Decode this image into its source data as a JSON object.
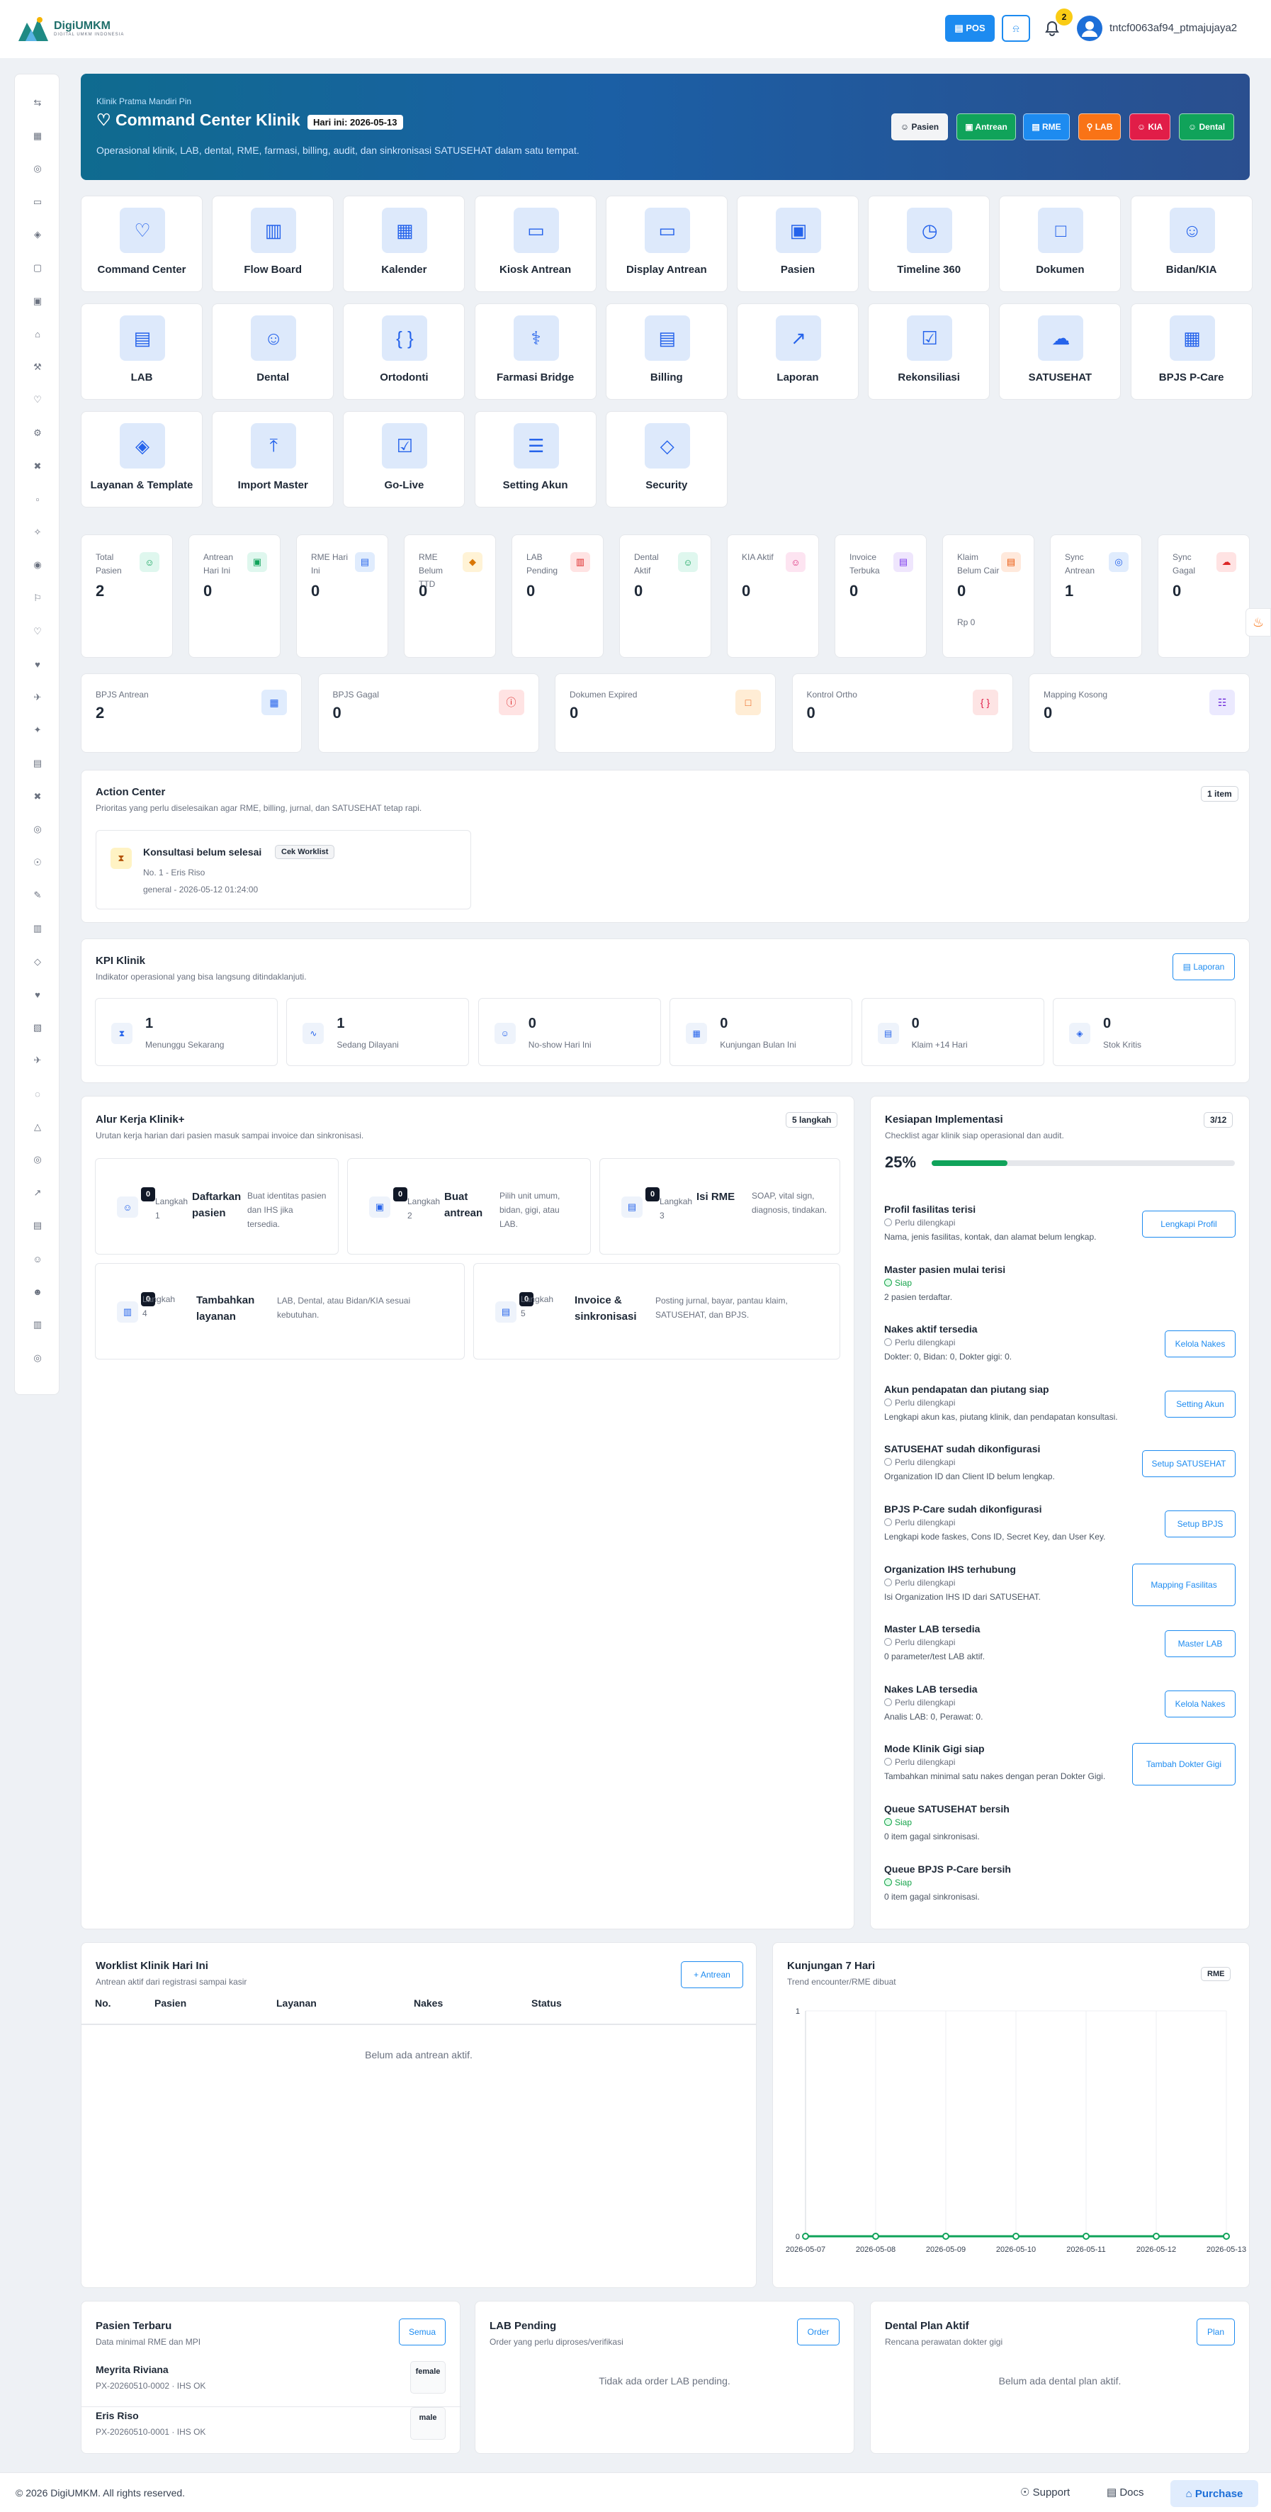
{
  "app": {
    "logo_name": "DigiUMKM",
    "logo_tagline": "DIGITAL UMKM INDONESIA",
    "pos": "▤ POS",
    "bell_icon": "⍾",
    "notif_count": "2",
    "user": "tntcf0063af94_ptmajujaya2"
  },
  "sidebar": [
    "⇆",
    "▦",
    "◎",
    "▭",
    "◈",
    "▢",
    "▣",
    "⌂",
    "⚒",
    "♡",
    "⚙",
    "✖",
    "▫",
    "✧",
    "◉",
    "⚐",
    "♡",
    "♥",
    "✈",
    "✦",
    "▤",
    "✖",
    "◎",
    "☉",
    "✎",
    "▥",
    "◇",
    "♥",
    "▧",
    "✈",
    "◌",
    "△",
    "◎",
    "↗",
    "▤",
    "☺",
    "☻",
    "▥",
    "◎"
  ],
  "hero": {
    "kicker": "Klinik Pratma Mandiri Pin",
    "title": "Command Center Klinik",
    "date": "Hari ini: 2026-05-13",
    "subtitle": "Operasional klinik, LAB, dental, RME, farmasi, billing, audit, dan sinkronisasi SATUSEHAT dalam satu tempat.",
    "buttons": [
      {
        "label": "☺ Pasien",
        "bg": "#f3f4f6",
        "fg": "#1f2937"
      },
      {
        "label": "▣ Antrean",
        "bg": "#10a35a",
        "fg": "#ffffff"
      },
      {
        "label": "▤ RME",
        "bg": "#1d8bf0",
        "fg": "#ffffff"
      },
      {
        "label": "⚲ LAB",
        "bg": "#f97316",
        "fg": "#ffffff"
      },
      {
        "label": "☺ KIA",
        "bg": "#e11d48",
        "fg": "#ffffff"
      },
      {
        "label": "☺ Dental",
        "bg": "#10a35a",
        "fg": "#ffffff"
      }
    ]
  },
  "tiles": [
    {
      "label": "Command Center",
      "icon": "♡"
    },
    {
      "label": "Flow Board",
      "icon": "▥"
    },
    {
      "label": "Kalender",
      "icon": "▦"
    },
    {
      "label": "Kiosk Antrean",
      "icon": "▭"
    },
    {
      "label": "Display Antrean",
      "icon": "▭"
    },
    {
      "label": "Pasien",
      "icon": "▣"
    },
    {
      "label": "Timeline 360",
      "icon": "◷"
    },
    {
      "label": "Dokumen",
      "icon": "□"
    },
    {
      "label": "Bidan/KIA",
      "icon": "☺"
    },
    {
      "label": "LAB",
      "icon": "▤"
    },
    {
      "label": "Dental",
      "icon": "☺"
    },
    {
      "label": "Ortodonti",
      "icon": "{ }"
    },
    {
      "label": "Farmasi Bridge",
      "icon": "⚕"
    },
    {
      "label": "Billing",
      "icon": "▤"
    },
    {
      "label": "Laporan",
      "icon": "↗"
    },
    {
      "label": "Rekonsiliasi",
      "icon": "☑"
    },
    {
      "label": "SATUSEHAT",
      "icon": "☁"
    },
    {
      "label": "BPJS P-Care",
      "icon": "▦"
    },
    {
      "label": "Layanan & Template",
      "icon": "◈"
    },
    {
      "label": "Import Master",
      "icon": "⤒"
    },
    {
      "label": "Go-Live",
      "icon": "☑"
    },
    {
      "label": "Setting Akun",
      "icon": "☰"
    },
    {
      "label": "Security",
      "icon": "◇"
    }
  ],
  "stats": [
    {
      "label": "Total Pasien",
      "value": "2",
      "icon": "☺",
      "bg": "#dff7ee",
      "fg": "#10a35a"
    },
    {
      "label": "Antrean Hari Ini",
      "value": "0",
      "icon": "▣",
      "bg": "#dff7ee",
      "fg": "#10a35a"
    },
    {
      "label": "RME Hari Ini",
      "value": "0",
      "icon": "▤",
      "bg": "#e0ecfd",
      "fg": "#2563eb"
    },
    {
      "label": "RME Belum TTD",
      "value": "0",
      "icon": "◆",
      "bg": "#fff3d6",
      "fg": "#d97706"
    },
    {
      "label": "LAB Pending",
      "value": "0",
      "icon": "▥",
      "bg": "#ffe3e3",
      "fg": "#dc2626"
    },
    {
      "label": "Dental Aktif",
      "value": "0",
      "icon": "☺",
      "bg": "#dff7ee",
      "fg": "#10a35a"
    },
    {
      "label": "KIA Aktif",
      "value": "0",
      "icon": "☺",
      "bg": "#fde4f1",
      "fg": "#db2777"
    },
    {
      "label": "Invoice Terbuka",
      "value": "0",
      "icon": "▤",
      "bg": "#efe6fd",
      "fg": "#7c3aed"
    },
    {
      "label": "Klaim Belum Cair",
      "value": "0",
      "icon": "▤",
      "bg": "#ffe9dc",
      "fg": "#ea580c",
      "extra": "Rp 0"
    },
    {
      "label": "Sync Antrean",
      "value": "1",
      "icon": "◎",
      "bg": "#e0ecfd",
      "fg": "#2563eb"
    },
    {
      "label": "Sync Gagal",
      "value": "0",
      "icon": "☁",
      "bg": "#ffe3e3",
      "fg": "#dc2626"
    }
  ],
  "stats2": [
    {
      "label": "BPJS Antrean",
      "value": "2",
      "icon": "▦",
      "bg": "#e0ecfd",
      "fg": "#2563eb"
    },
    {
      "label": "BPJS Gagal",
      "value": "0",
      "icon": "ⓘ",
      "bg": "#ffe3e3",
      "fg": "#dc2626"
    },
    {
      "label": "Dokumen Expired",
      "value": "0",
      "icon": "□",
      "bg": "#ffedd5",
      "fg": "#ea580c"
    },
    {
      "label": "Kontrol Ortho",
      "value": "0",
      "icon": "{ }",
      "bg": "#fde4e4",
      "fg": "#e11d48"
    },
    {
      "label": "Mapping Kosong",
      "value": "0",
      "icon": "☷",
      "bg": "#ebe9fe",
      "fg": "#6d28d9"
    }
  ],
  "action": {
    "title": "Action Center",
    "sub": "Prioritas yang perlu diselesaikan agar RME, billing, jurnal, dan SATUSEHAT tetap rapi.",
    "count": "1 item",
    "item_title": "Konsultasi belum selesai",
    "item_btn": "Cek Worklist",
    "item_l1": "No. 1 - Eris Riso",
    "item_l2": "general - 2026-05-12 01:24:00",
    "item_icon": "⧗"
  },
  "kpi": {
    "title": "KPI Klinik",
    "sub": "Indikator operasional yang bisa langsung ditindaklanjuti.",
    "btn": "▤ Laporan",
    "items": [
      {
        "value": "1",
        "label": "Menunggu Sekarang",
        "icon": "⧗"
      },
      {
        "value": "1",
        "label": "Sedang Dilayani",
        "icon": "∿"
      },
      {
        "value": "0",
        "label": "No-show Hari Ini",
        "icon": "☺"
      },
      {
        "value": "0",
        "label": "Kunjungan Bulan Ini",
        "icon": "▦"
      },
      {
        "value": "0",
        "label": "Klaim +14 Hari",
        "icon": "▤"
      },
      {
        "value": "0",
        "label": "Stok Kritis",
        "icon": "◈"
      }
    ]
  },
  "flow": {
    "title": "Alur Kerja Klinik+",
    "sub": "Urutan kerja harian dari pasien masuk sampai invoice dan sinkronisasi.",
    "count": "5 langkah",
    "steps": [
      {
        "n": "0",
        "ic": "☺",
        "step": "Langkah 1",
        "name": "Daftarkan pasien",
        "desc": "Buat identitas pasien dan IHS jika tersedia."
      },
      {
        "n": "0",
        "ic": "▣",
        "step": "Langkah 2",
        "name": "Buat antrean",
        "desc": "Pilih unit umum, bidan, gigi, atau LAB."
      },
      {
        "n": "0",
        "ic": "▤",
        "step": "Langkah 3",
        "name": "Isi RME",
        "desc": "SOAP, vital sign, diagnosis, tindakan."
      },
      {
        "n": "0",
        "ic": "▥",
        "step": "Langkah 4",
        "name": "Tambahkan layanan",
        "desc": "LAB, Dental, atau Bidan/KIA sesuai kebutuhan."
      },
      {
        "n": "0",
        "ic": "▤",
        "step": "Langkah 5",
        "name": "Invoice & sinkronisasi",
        "desc": "Posting jurnal, bayar, pantau klaim, SATUSEHAT, dan BPJS."
      }
    ]
  },
  "ready": {
    "title": "Kesiapan Implementasi",
    "sub": "Checklist agar klinik siap operasional dan audit.",
    "count": "3/12",
    "percent": "25%",
    "progress": 0.25,
    "items": [
      {
        "t": "Profil fasilitas terisi",
        "s": "Perlu dilengkapi",
        "ok": false,
        "d": "Nama, jenis fasilitas, kontak, dan alamat belum lengkap.",
        "btn": "Lengkapi Profil"
      },
      {
        "t": "Master pasien mulai terisi",
        "s": "Siap",
        "ok": true,
        "d": "2 pasien terdaftar.",
        "btn": ""
      },
      {
        "t": "Nakes aktif tersedia",
        "s": "Perlu dilengkapi",
        "ok": false,
        "d": "Dokter: 0, Bidan: 0, Dokter gigi: 0.",
        "btn": "Kelola Nakes"
      },
      {
        "t": "Akun pendapatan dan piutang siap",
        "s": "Perlu dilengkapi",
        "ok": false,
        "d": "Lengkapi akun kas, piutang klinik, dan pendapatan konsultasi.",
        "btn": "Setting Akun"
      },
      {
        "t": "SATUSEHAT sudah dikonfigurasi",
        "s": "Perlu dilengkapi",
        "ok": false,
        "d": "Organization ID dan Client ID belum lengkap.",
        "btn": "Setup SATUSEHAT"
      },
      {
        "t": "BPJS P-Care sudah dikonfigurasi",
        "s": "Perlu dilengkapi",
        "ok": false,
        "d": "Lengkapi kode faskes, Cons ID, Secret Key, dan User Key.",
        "btn": "Setup BPJS"
      },
      {
        "t": "Organization IHS terhubung",
        "s": "Perlu dilengkapi",
        "ok": false,
        "d": "Isi Organization IHS ID dari SATUSEHAT.",
        "btn": "Mapping Fasilitas"
      },
      {
        "t": "Master LAB tersedia",
        "s": "Perlu dilengkapi",
        "ok": false,
        "d": "0 parameter/test LAB aktif.",
        "btn": "Master LAB"
      },
      {
        "t": "Nakes LAB tersedia",
        "s": "Perlu dilengkapi",
        "ok": false,
        "d": "Analis LAB: 0, Perawat: 0.",
        "btn": "Kelola Nakes"
      },
      {
        "t": "Mode Klinik Gigi siap",
        "s": "Perlu dilengkapi",
        "ok": false,
        "d": "Tambahkan minimal satu nakes dengan peran Dokter Gigi.",
        "btn": "Tambah Dokter Gigi"
      },
      {
        "t": "Queue SATUSEHAT bersih",
        "s": "Siap",
        "ok": true,
        "d": "0 item gagal sinkronisasi.",
        "btn": ""
      },
      {
        "t": "Queue BPJS P-Care bersih",
        "s": "Siap",
        "ok": true,
        "d": "0 item gagal sinkronisasi.",
        "btn": ""
      }
    ]
  },
  "worklist": {
    "title": "Worklist Klinik Hari Ini",
    "sub": "Antrean aktif dari registrasi sampai kasir",
    "btn": "+ Antrean",
    "cols": [
      "No.",
      "Pasien",
      "Layanan",
      "Nakes",
      "Status"
    ],
    "empty": "Belum ada antrean aktif."
  },
  "chart_data": {
    "type": "line",
    "title": "Kunjungan 7 Hari",
    "subtitle": "Trend encounter/RME dibuat",
    "badge": "RME",
    "categories": [
      "2026-05-07",
      "2026-05-08",
      "2026-05-09",
      "2026-05-10",
      "2026-05-11",
      "2026-05-12",
      "2026-05-13"
    ],
    "series": [
      {
        "values": [
          0,
          0,
          0,
          0,
          0,
          0,
          0
        ]
      }
    ],
    "ylim": [
      0,
      1
    ],
    "yticks": [
      "0",
      "1"
    ],
    "color": "#10a35a"
  },
  "recent": {
    "title": "Pasien Terbaru",
    "sub": "Data minimal RME dan MPI",
    "btn": "Semua",
    "rows": [
      {
        "name": "Meyrita Riviana",
        "id": "PX-20260510-0002 · IHS OK",
        "g": "female"
      },
      {
        "name": "Eris Riso",
        "id": "PX-20260510-0001 · IHS OK",
        "g": "male"
      }
    ]
  },
  "lab": {
    "title": "LAB Pending",
    "sub": "Order yang perlu diproses/verifikasi",
    "btn": "Order",
    "empty": "Tidak ada order LAB pending."
  },
  "dental": {
    "title": "Dental Plan Aktif",
    "sub": "Rencana perawatan dokter gigi",
    "btn": "Plan",
    "empty": "Belum ada dental plan aktif."
  },
  "footer": {
    "copy": "© 2026 DigiUMKM. All rights reserved.",
    "support": "☉  Support",
    "docs": "▤  Docs",
    "purchase": "⌂  Purchase"
  },
  "fab_icon": "♨"
}
